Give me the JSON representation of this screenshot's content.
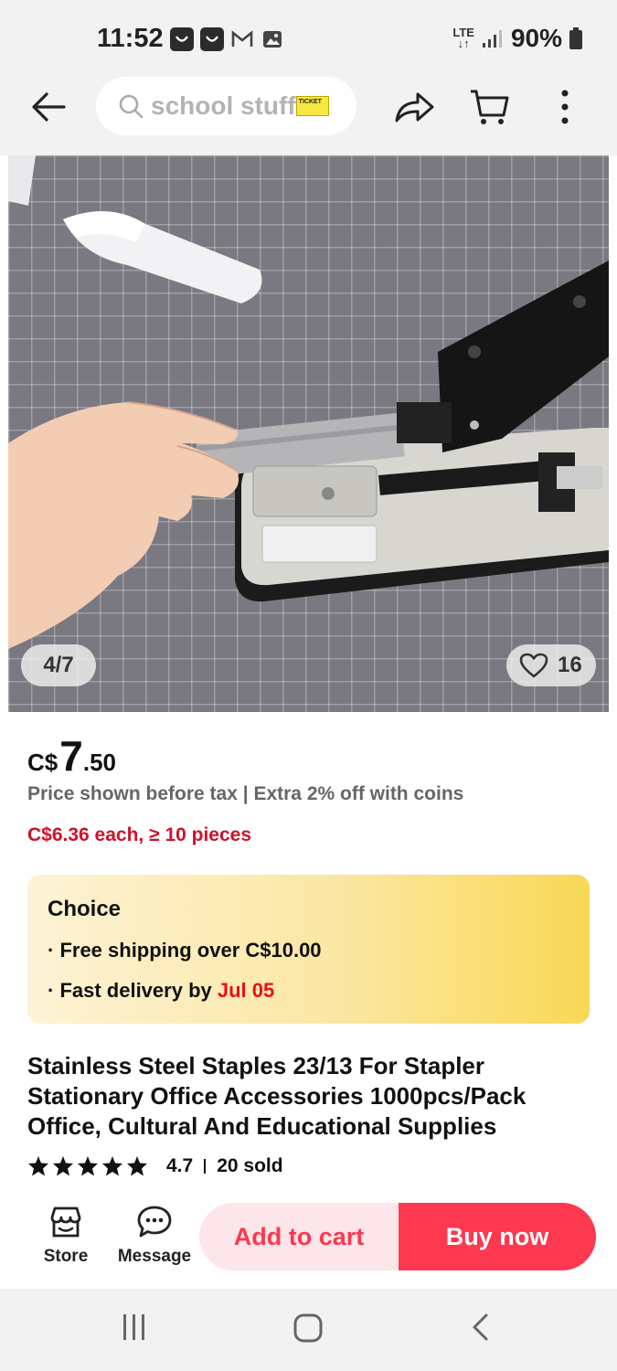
{
  "status_bar": {
    "time": "11:52",
    "network": "LTE",
    "battery": "90%",
    "notification_icons": [
      "aliexpress-icon",
      "aliexpress-icon",
      "gmail-icon",
      "gallery-icon"
    ]
  },
  "header": {
    "search_text": "school stuff",
    "search_tag": "TICKET",
    "icons": [
      "back-arrow-icon",
      "search-icon",
      "share-icon",
      "cart-icon",
      "more-vert-icon"
    ]
  },
  "gallery": {
    "counter": "4/7",
    "likes": "16"
  },
  "price": {
    "currency": "C$",
    "integer": "7",
    "decimal": ".50",
    "note": "Price shown before tax | Extra 2% off with coins",
    "bulk": "C$6.36 each, ≥ 10 pieces"
  },
  "choice": {
    "title": "Choice",
    "line1": "· Free shipping over C$10.00",
    "line2_prefix": "· Fast delivery by ",
    "line2_date": "Jul 05"
  },
  "product": {
    "title": "Stainless Steel Staples 23/13 For Stapler Stationary Office Accessories 1000pcs/Pack Office, Cultural And Educational Supplies",
    "rating": "4.7",
    "stars": 5,
    "sold": "20 sold"
  },
  "bottom_bar": {
    "store_label": "Store",
    "message_label": "Message",
    "add_to_cart": "Add to cart",
    "buy_now": "Buy now"
  },
  "colors": {
    "accent": "#fd384f",
    "accent_light": "#fde6ea",
    "bulk_price": "#d0112b",
    "choice_gradient_end": "#f9d855"
  }
}
